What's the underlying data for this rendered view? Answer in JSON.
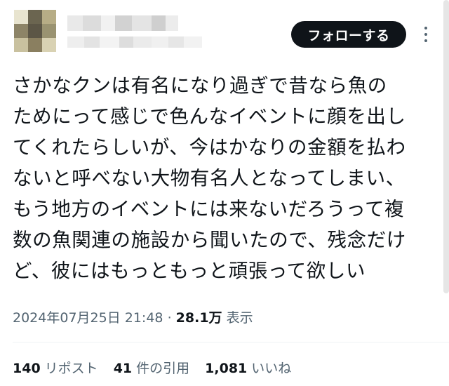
{
  "author": {
    "avatar_colors": [
      "#e8e4cf",
      "#6b6550",
      "#b7ad86",
      "#8d8467",
      "#5c5646",
      "#9a9371",
      "#c9c19f",
      "#8a7f60",
      "#d9d2b3"
    ],
    "name_blur_colors": [
      "#e9e9e9",
      "#dcdcdc",
      "#f1f1f1",
      "#d2d2d2",
      "#e4e4e4",
      "#cfcfcf",
      "#ececec"
    ],
    "handle_blur_colors": [
      "#eeeeee",
      "#e3e3e3",
      "#f3f3f3",
      "#dddddd",
      "#ebebeb",
      "#f0f0f0",
      "#e6e6e6",
      "#f2f2f2"
    ]
  },
  "follow_button": {
    "label": "フォローする",
    "bg": "#0f1419"
  },
  "more_icon": "more-vertical-icon",
  "tweet": {
    "lines": [
      "さかなクンは有名になり過ぎで昔なら魚の",
      "ためにって感じで色んなイベントに顔を出し",
      "てくれたらしいが、今はかなりの金額を払わ",
      "ないと呼べない大物有名人となってしまい、",
      "もう地方のイベントには来ないだろうって複",
      "数の魚関連の施設から聞いたので、残念だけ",
      "ど、彼にはもっともっと頑張って欲しい"
    ]
  },
  "meta": {
    "timestamp": "2024年07月25日 21:48",
    "separator": "·",
    "views_count": "28.1万",
    "views_label": "表示"
  },
  "stats": {
    "reposts_count": "140",
    "reposts_label": "リポスト",
    "quotes_count": "41",
    "quotes_label": "件の引用",
    "likes_count": "1,081",
    "likes_label": "いいね"
  },
  "colors": {
    "text": "#0f1419",
    "secondary": "#536471",
    "divider": "#eff3f4"
  }
}
